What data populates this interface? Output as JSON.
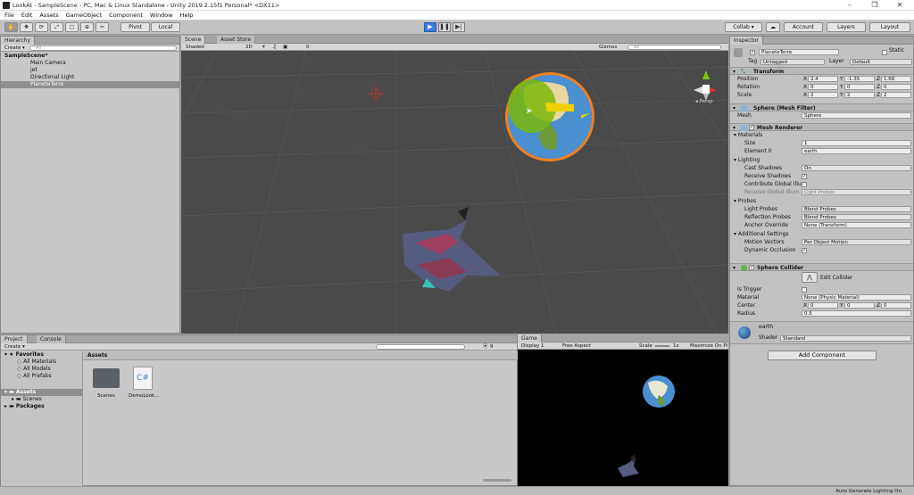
{
  "window": {
    "title": "LookAt - SampleScene - PC, Mac & Linux Standalone - Unity 2019.2.15f1 Personal* <DX11>",
    "controls": [
      "–",
      "❐",
      "✕"
    ]
  },
  "menu": [
    "File",
    "Edit",
    "Assets",
    "GameObject",
    "Component",
    "Window",
    "Help"
  ],
  "toolbar": {
    "tools": [
      "✋",
      "✥",
      "⟳",
      "⤢",
      "▢",
      "⊕",
      "✂"
    ],
    "pivot": "Pivot",
    "space": "Local",
    "collab": "Collab ▾",
    "account": "Account",
    "layers": "Layers",
    "layout": "Layout"
  },
  "hierarchy": {
    "tab": "Hierarchy",
    "create": "Create ▾",
    "search": "All",
    "scene": "SampleScene*",
    "items": [
      "Main Camera",
      "jet",
      "Directional Light",
      "PlaneteTerre"
    ]
  },
  "scene": {
    "tabs": [
      "Scene",
      "Asset Store"
    ],
    "shading": "Shaded",
    "mode2d": "2D",
    "counter": "0",
    "gizmos": "Gizmos",
    "search": "All",
    "persp": "◂ Persp"
  },
  "inspector": {
    "tab": "Inspector",
    "object_name": "PlaneteTerre",
    "static_label": "Static",
    "tag_label": "Tag",
    "tag": "Untagged",
    "layer_label": "Layer",
    "layer": "Default",
    "transform": {
      "title": "Transform",
      "position_label": "Position",
      "position": [
        "2.4",
        "-1.35",
        "1.68"
      ],
      "rotation_label": "Rotation",
      "rotation": [
        "0",
        "0",
        "0"
      ],
      "scale_label": "Scale",
      "scale": [
        "2",
        "2",
        "2"
      ]
    },
    "mesh_filter": {
      "title": "Sphere (Mesh Filter)",
      "mesh_label": "Mesh",
      "mesh": "Sphere"
    },
    "mesh_renderer": {
      "title": "Mesh Renderer",
      "materials": "Materials",
      "size_label": "Size",
      "size": "1",
      "element_label": "Element 0",
      "element": "earth",
      "lighting": "Lighting",
      "cast_label": "Cast Shadows",
      "cast": "On",
      "receive_label": "Receive Shadows",
      "contribute_label": "Contribute Global Illu",
      "receive_gi_label": "Receive Global Illum",
      "receive_gi": "Light Probes",
      "probes": "Probes",
      "light_probes_label": "Light Probes",
      "light_probes": "Blend Probes",
      "reflection_label": "Reflection Probes",
      "reflection": "Blend Probes",
      "anchor_label": "Anchor Override",
      "anchor": "None (Transform)",
      "additional": "Additional Settings",
      "motion_label": "Motion Vectors",
      "motion": "Per Object Motion",
      "occlusion_label": "Dynamic Occlusion"
    },
    "collider": {
      "title": "Sphere Collider",
      "edit": "Edit Collider",
      "trigger_label": "Is Trigger",
      "material_label": "Material",
      "material": "None (Physic Material)",
      "center_label": "Center",
      "center": [
        "0",
        "0",
        "0"
      ],
      "radius_label": "Radius",
      "radius": "0.5"
    },
    "material": {
      "name": "earth",
      "shader_label": "Shader",
      "shader": "Standard"
    },
    "add_component": "Add Component"
  },
  "project": {
    "tabs": [
      "Project",
      "Console"
    ],
    "create": "Create ▾",
    "favorites": "Favorites",
    "fav_items": [
      "All Materials",
      "All Models",
      "All Prefabs"
    ],
    "assets": "Assets",
    "asset_items": [
      "Scenes"
    ],
    "packages": "Packages",
    "breadcrumb": "Assets",
    "files": [
      {
        "name": "Scenes",
        "kind": "folder"
      },
      {
        "name": "DemoLook...",
        "kind": "script",
        "glyph": "C#"
      }
    ],
    "counter": "9"
  },
  "game": {
    "tab": "Game",
    "display": "Display 1",
    "aspect": "Free Aspect",
    "scale_label": "Scale",
    "scale": "1x",
    "maximize": "Maximize On Pl"
  },
  "status": "Auto Generate Lighting On",
  "colors": {
    "accent": "#3b7de0",
    "selection": "#8f8f8f",
    "orange_outline": "#f08020"
  }
}
